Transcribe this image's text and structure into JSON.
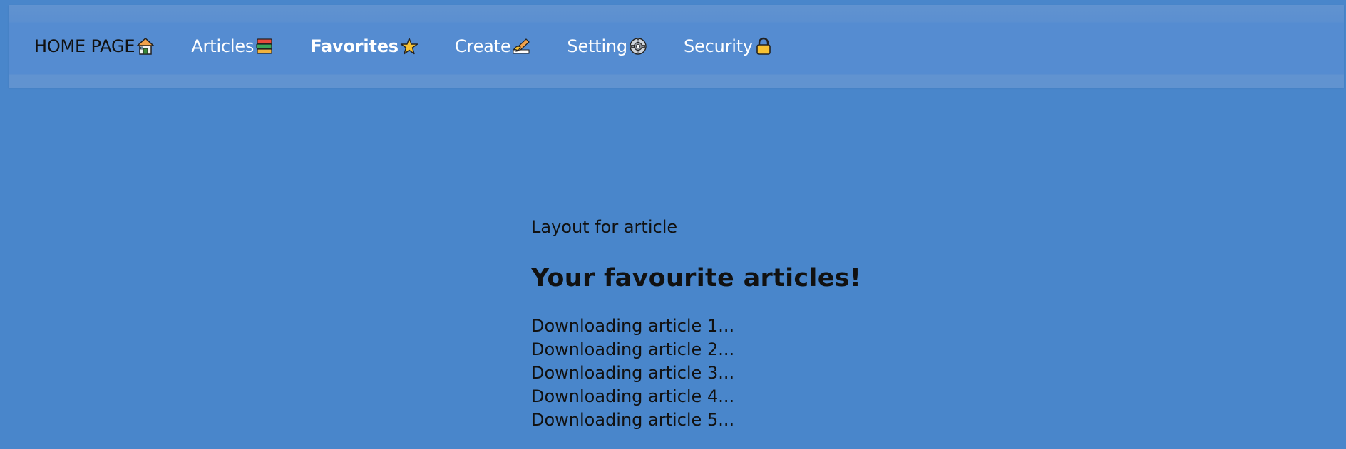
{
  "nav": {
    "items": [
      {
        "label": "HOME PAGE",
        "icon": "house-icon"
      },
      {
        "label": "Articles",
        "icon": "books-icon"
      },
      {
        "label": "Favorites",
        "icon": "star-icon"
      },
      {
        "label": "Create",
        "icon": "writing-hand-icon"
      },
      {
        "label": "Setting",
        "icon": "gear-icon"
      },
      {
        "label": "Security",
        "icon": "lock-icon"
      }
    ]
  },
  "main": {
    "subtitle": "Layout for article",
    "heading": "Your favourite articles!",
    "articles": [
      "Downloading article 1...",
      "Downloading article 2...",
      "Downloading article 3...",
      "Downloading article 4...",
      "Downloading article 5..."
    ]
  },
  "colors": {
    "background": "#4986cb",
    "navbar": "#558cd1",
    "nav_text": "#ffffff",
    "text": "#111111"
  }
}
